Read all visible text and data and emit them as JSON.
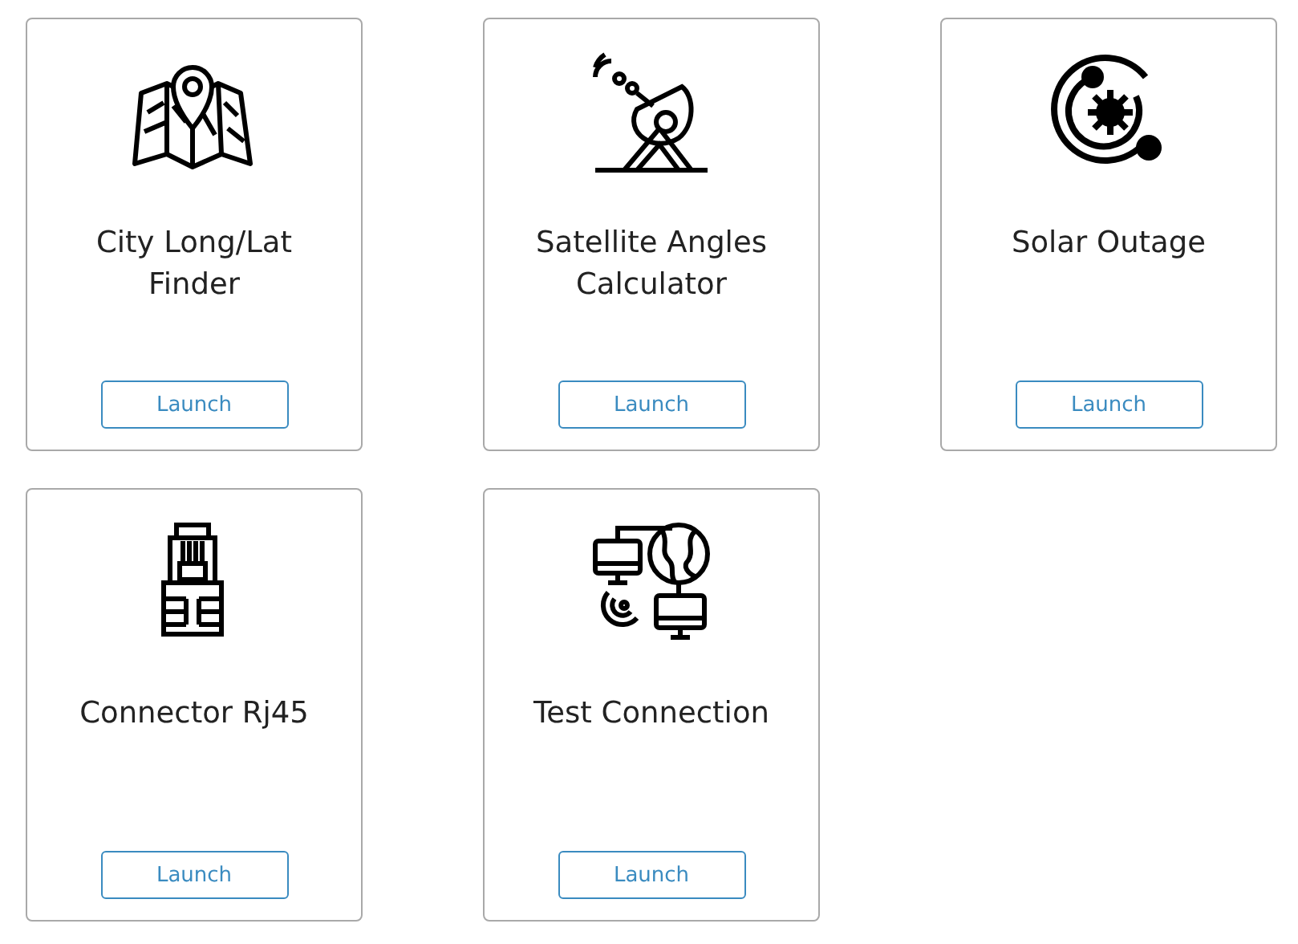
{
  "tools": [
    {
      "title": "City Long/Lat Finder",
      "button": "Launch"
    },
    {
      "title": "Satellite Angles Calculator",
      "button": "Launch"
    },
    {
      "title": "Solar Outage",
      "button": "Launch"
    },
    {
      "title": "Connector Rj45",
      "button": "Launch"
    },
    {
      "title": "Test Connection",
      "button": "Launch"
    }
  ]
}
